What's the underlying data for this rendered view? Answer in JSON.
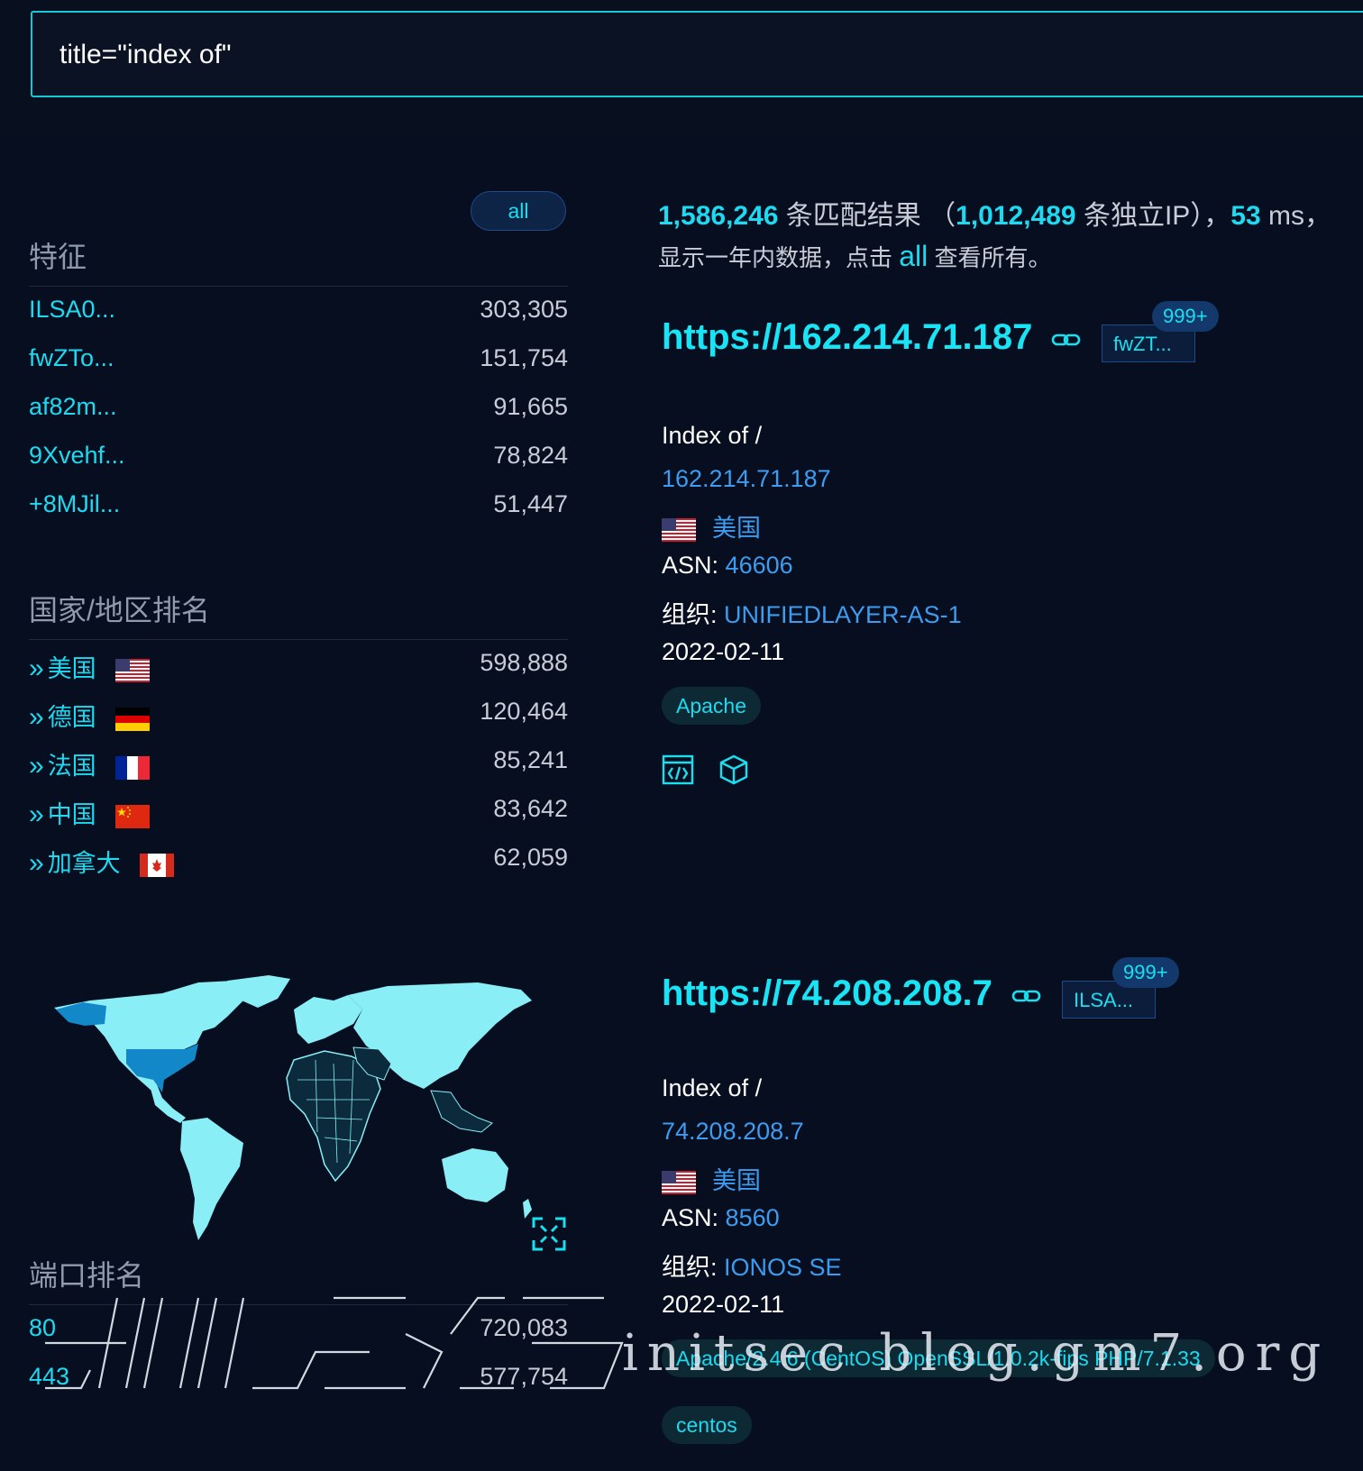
{
  "search": {
    "value": "title=\"index of\""
  },
  "sidebar": {
    "all_label": "all",
    "features": {
      "title": "特征",
      "items": [
        {
          "label": "ILSA0...",
          "count": "303,305"
        },
        {
          "label": "fwZTo...",
          "count": "151,754"
        },
        {
          "label": "af82m...",
          "count": "91,665"
        },
        {
          "label": "9Xvehf...",
          "count": "78,824"
        },
        {
          "label": "+8MJil...",
          "count": "51,447"
        }
      ]
    },
    "countries": {
      "title": "国家/地区排名",
      "items": [
        {
          "label": "美国",
          "count": "598,888",
          "flag": "us-flag"
        },
        {
          "label": "德国",
          "count": "120,464",
          "flag": "de-flag"
        },
        {
          "label": "法国",
          "count": "85,241",
          "flag": "fr-flag"
        },
        {
          "label": "中国",
          "count": "83,642",
          "flag": "cn-flag"
        },
        {
          "label": "加拿大",
          "count": "62,059",
          "flag": "ca-flag"
        }
      ]
    },
    "ports": {
      "title": "端口排名",
      "items": [
        {
          "label": "80",
          "count": "720,083"
        },
        {
          "label": "443",
          "count": "577,754"
        }
      ]
    }
  },
  "summary": {
    "total": "1,586,246",
    "total_suffix": " 条匹配结果 （",
    "unique": "1,012,489",
    "unique_suffix": " 条独立IP），",
    "time": "53",
    "time_suffix": " ms，",
    "line2_prefix": "显示一年内数据，点击 ",
    "line2_link": "all",
    "line2_suffix": " 查看所有。"
  },
  "results": [
    {
      "url": "https://162.214.71.187",
      "tag": "fwZT...",
      "badge": "999+",
      "title": "Index of /",
      "ip": "162.214.71.187",
      "country": "美国",
      "asn_label": "ASN:",
      "asn": "46606",
      "org_label": "组织:",
      "org": "UNIFIEDLAYER-AS-1",
      "date": "2022-02-11",
      "pills": [
        "Apache"
      ]
    },
    {
      "url": "https://74.208.208.7",
      "tag": "ILSA...",
      "badge": "999+",
      "title": "Index of /",
      "ip": "74.208.208.7",
      "country": "美国",
      "asn_label": "ASN:",
      "asn": "8560",
      "org_label": "组织:",
      "org": "IONOS SE",
      "date": "2022-02-11",
      "pills": [
        "Apache/2.4.6 (CentOS) OpenSSL/1.0.2k-fips PHP/7.1.33",
        "centos"
      ]
    }
  ],
  "watermark": {
    "text": "initsec blog.gm7.org"
  },
  "colors": {
    "accent": "#19e0f0",
    "link": "#3d9cf0",
    "background": "#060e1f",
    "map_land": "#8aeef7",
    "map_highlight": "#1388c9"
  }
}
